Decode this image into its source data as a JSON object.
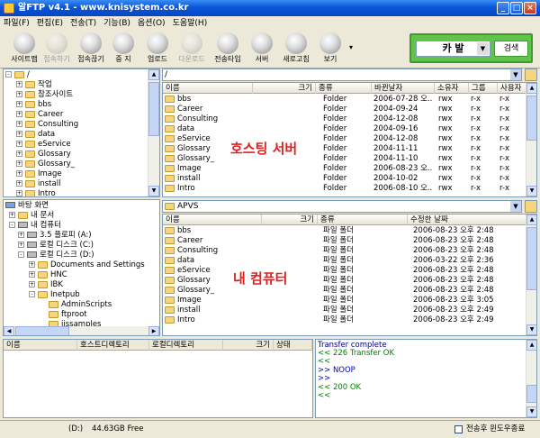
{
  "app": {
    "title": "알FTP v4.1 - www.knisystem.co.kr"
  },
  "menu": [
    "파일(F)",
    "편집(E)",
    "전송(T)",
    "기능(B)",
    "옵션(O)",
    "도움말(H)"
  ],
  "toolbar": [
    {
      "label": "사이트맵",
      "icon": "sitemap-icon",
      "enabled": true
    },
    {
      "label": "접속하기",
      "icon": "connect-icon",
      "enabled": false
    },
    {
      "label": "접속끊기",
      "icon": "disconnect-icon",
      "enabled": true
    },
    {
      "label": "중 지",
      "icon": "stop-icon",
      "enabled": true
    },
    {
      "label": "업로드",
      "icon": "upload-icon",
      "enabled": true
    },
    {
      "label": "다운로드",
      "icon": "download-icon",
      "enabled": false
    },
    {
      "label": "전송타입",
      "icon": "transfer-type-icon",
      "enabled": true
    },
    {
      "label": "서버",
      "icon": "server-icon",
      "enabled": true
    },
    {
      "label": "새로고침",
      "icon": "refresh-icon",
      "enabled": true
    },
    {
      "label": "보기",
      "icon": "view-icon",
      "enabled": true
    }
  ],
  "search": {
    "selected": "카 발",
    "button": "검색"
  },
  "remote_tree": {
    "root": "/",
    "items": [
      "작업",
      "참조사이트",
      "bbs",
      "Career",
      "Consulting",
      "data",
      "eService",
      "Glossary",
      "Glossary_",
      "Image",
      "install",
      "Intro"
    ]
  },
  "remote": {
    "path": "/",
    "columns": [
      "이름",
      "크기",
      "종류",
      "바뀐날자",
      "소유자",
      "그룹",
      "사용자"
    ],
    "rows": [
      [
        "bbs",
        "",
        "Folder",
        "2006-07-28 오..",
        "rwx",
        "r-x",
        "r-x"
      ],
      [
        "Career",
        "",
        "Folder",
        "2004-09-24",
        "rwx",
        "r-x",
        "r-x"
      ],
      [
        "Consulting",
        "",
        "Folder",
        "2004-12-08",
        "rwx",
        "r-x",
        "r-x"
      ],
      [
        "data",
        "",
        "Folder",
        "2004-09-16",
        "rwx",
        "r-x",
        "r-x"
      ],
      [
        "eService",
        "",
        "Folder",
        "2004-12-08",
        "rwx",
        "r-x",
        "r-x"
      ],
      [
        "Glossary",
        "",
        "Folder",
        "2004-11-11",
        "rwx",
        "r-x",
        "r-x"
      ],
      [
        "Glossary_",
        "",
        "Folder",
        "2004-11-10",
        "rwx",
        "r-x",
        "r-x"
      ],
      [
        "Image",
        "",
        "Folder",
        "2006-08-23 오..",
        "rwx",
        "r-x",
        "r-x"
      ],
      [
        "install",
        "",
        "Folder",
        "2004-10-02",
        "rwx",
        "r-x",
        "r-x"
      ],
      [
        "Intro",
        "",
        "Folder",
        "2006-08-10 오..",
        "rwx",
        "r-x",
        "r-x"
      ]
    ],
    "overlay": "호스팅 서버"
  },
  "local_tree": {
    "items": [
      {
        "label": "바탕 화면",
        "level": 0,
        "kind": "desktop"
      },
      {
        "label": "내 문서",
        "level": 1,
        "kind": "folder",
        "exp": "+"
      },
      {
        "label": "내 컴퓨터",
        "level": 1,
        "kind": "computer",
        "exp": "-"
      },
      {
        "label": "3.5 플로피 (A:)",
        "level": 2,
        "kind": "drive",
        "exp": "+"
      },
      {
        "label": "로컬 디스크 (C:)",
        "level": 2,
        "kind": "drive",
        "exp": "+"
      },
      {
        "label": "로컬 디스크 (D:)",
        "level": 2,
        "kind": "drive",
        "exp": "-"
      },
      {
        "label": "Documents and Settings",
        "level": 3,
        "kind": "folder",
        "exp": "+"
      },
      {
        "label": "HNC",
        "level": 3,
        "kind": "folder",
        "exp": "+"
      },
      {
        "label": "IBK",
        "level": 3,
        "kind": "folder",
        "exp": "+"
      },
      {
        "label": "Inetpub",
        "level": 3,
        "kind": "folder",
        "exp": "-"
      },
      {
        "label": "AdminScripts",
        "level": 4,
        "kind": "folder",
        "exp": ""
      },
      {
        "label": "ftproot",
        "level": 4,
        "kind": "folder",
        "exp": ""
      },
      {
        "label": "iissamples",
        "level": 4,
        "kind": "folder",
        "exp": ""
      }
    ]
  },
  "local": {
    "path": "APVS",
    "columns": [
      "이름",
      "크기",
      "종류",
      "수정한 날짜"
    ],
    "rows": [
      [
        "bbs",
        "",
        "파일 폴더",
        "2006-08-23 오후 2:48"
      ],
      [
        "Career",
        "",
        "파일 폴더",
        "2006-08-23 오후 2:48"
      ],
      [
        "Consulting",
        "",
        "파일 폴더",
        "2006-08-23 오후 2:48"
      ],
      [
        "data",
        "",
        "파일 폴더",
        "2006-03-22 오후 2:36"
      ],
      [
        "eService",
        "",
        "파일 폴더",
        "2006-08-23 오후 2:48"
      ],
      [
        "Glossary",
        "",
        "파일 폴더",
        "2006-08-23 오후 2:48"
      ],
      [
        "Glossary_",
        "",
        "파일 폴더",
        "2006-08-23 오후 2:48"
      ],
      [
        "Image",
        "",
        "파일 폴더",
        "2006-08-23 오후 3:05"
      ],
      [
        "install",
        "",
        "파일 폴더",
        "2006-08-23 오후 2:49"
      ],
      [
        "Intro",
        "",
        "파일 폴더",
        "2006-08-23 오후 2:49"
      ]
    ],
    "overlay": "내 컴퓨터"
  },
  "queue": {
    "columns": [
      "이름",
      "호스트디렉토리",
      "로컬디렉토리",
      "크기",
      "상태"
    ]
  },
  "log": [
    {
      "text": "Transfer complete",
      "color": "#000080"
    },
    {
      "text": "<< 226 Transfer OK",
      "color": "#008000"
    },
    {
      "text": "<<",
      "color": "#008000"
    },
    {
      "text": ">> NOOP",
      "color": "#0000c0"
    },
    {
      "text": ">>",
      "color": "#0000c0"
    },
    {
      "text": "<< 200 OK",
      "color": "#008000"
    },
    {
      "text": "<<",
      "color": "#008000"
    }
  ],
  "status": {
    "drive": "(D:)",
    "free": "44.63GB Free",
    "checkbox_label": "전송후 윈도우종료",
    "checked": false
  }
}
